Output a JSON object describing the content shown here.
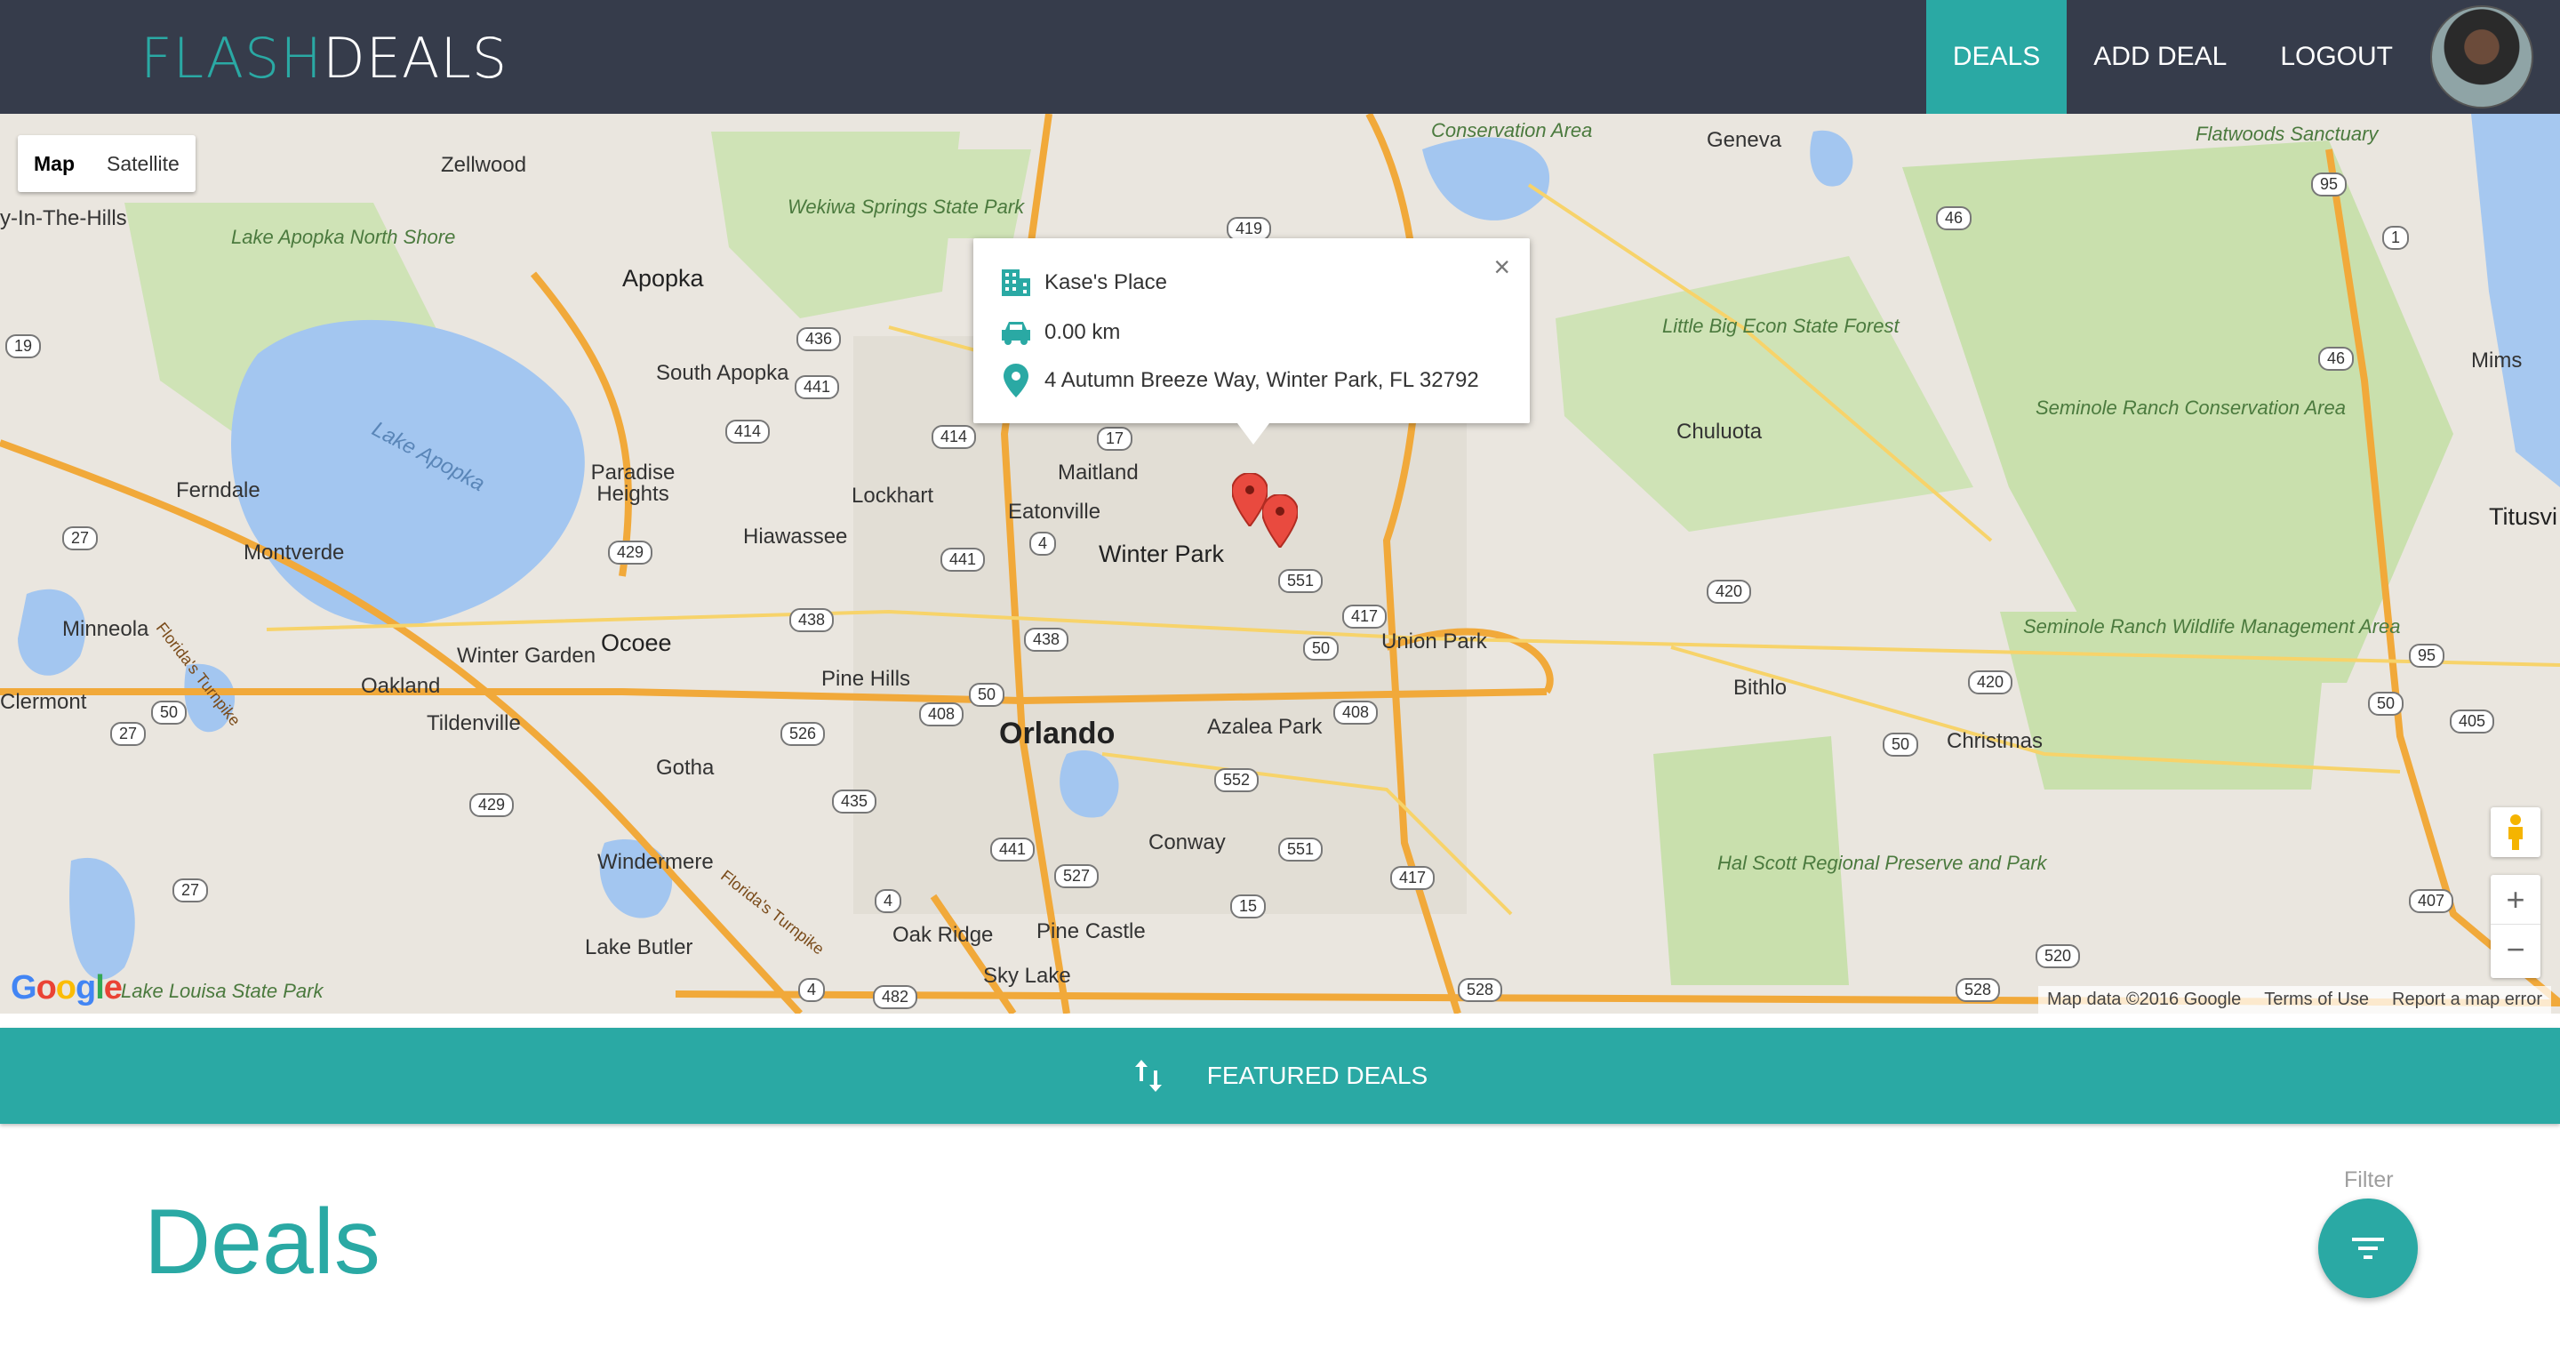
{
  "header": {
    "logo_part1": "FLASH",
    "logo_part2": "DEALS",
    "nav": [
      {
        "label": "DEALS",
        "active": true
      },
      {
        "label": "ADD DEAL",
        "active": false
      },
      {
        "label": "LOGOUT",
        "active": false
      }
    ]
  },
  "map": {
    "type_controls": {
      "map": "Map",
      "satellite": "Satellite",
      "selected": "Map"
    },
    "info_window": {
      "name": "Kase's Place",
      "distance": "0.00 km",
      "address": "4 Autumn Breeze Way, Winter Park, FL 32792",
      "close": "×"
    },
    "labels": {
      "zellwood": "Zellwood",
      "geneva": "Geneva",
      "apopka": "Apopka",
      "south_apopka": "South Apopka",
      "lake_apopka_north_shore": "Lake Apopka North Shore",
      "lake_apopka": "Lake Apopka",
      "wekiwa": "Wekiwa Springs State Park",
      "ferndale": "Ferndale",
      "paradise_heights": "Paradise Heights",
      "lockhart": "Lockhart",
      "maitland": "Maitland",
      "eatonville": "Eatonville",
      "winter_park": "Winter Park",
      "hiawassee": "Hiawassee",
      "montverde": "Montverde",
      "minneola": "Minneola",
      "ocoee": "Ocoee",
      "winter_garden": "Winter Garden",
      "oakland": "Oakland",
      "clermont": "Clermont",
      "tildenville": "Tildenville",
      "pine_hills": "Pine Hills",
      "orlando": "Orlando",
      "azalea_park": "Azalea Park",
      "union_park": "Union Park",
      "gotha": "Gotha",
      "conway": "Conway",
      "windermere": "Windermere",
      "pine_castle": "Pine Castle",
      "oak_ridge": "Oak Ridge",
      "lake_butler": "Lake Butler",
      "sky_lake": "Sky Lake",
      "lake_louisa": "Lake Louisa State Park",
      "chuluota": "Chuluota",
      "little_big_econ": "Little Big Econ State Forest",
      "seminole_conservation": "Seminole Ranch Conservation Area",
      "seminole_wildlife": "Seminole Ranch Wildlife Management Area",
      "bithlo": "Bithlo",
      "christmas": "Christmas",
      "hal_scott": "Hal Scott Regional Preserve and Park",
      "mims": "Mims",
      "titusville": "Titusvi",
      "flatwoods": "Flatwoods Sanctuary",
      "conservation_area": "Conservation Area",
      "hills": "y-In-The-Hills",
      "florida_turnpike": "Florida's Turnpike"
    },
    "shields": [
      "419",
      "436",
      "441",
      "414",
      "17",
      "414",
      "429",
      "441",
      "438",
      "438",
      "408",
      "50",
      "526",
      "435",
      "441",
      "408",
      "552",
      "551",
      "417",
      "50",
      "15",
      "527",
      "482",
      "528",
      "528",
      "520",
      "420",
      "420",
      "50",
      "405",
      "407",
      "46",
      "46",
      "95",
      "1",
      "27",
      "27",
      "50",
      "429",
      "27",
      "19",
      "4",
      "4",
      "4",
      "95",
      "50",
      "551",
      "417"
    ],
    "footer": {
      "map_data": "Map data ©2016 Google",
      "terms": "Terms of Use",
      "report": "Report a map error"
    },
    "google": "Google"
  },
  "featured": {
    "label": "FEATURED DEALS"
  },
  "deals": {
    "title": "Deals",
    "filter_label": "Filter"
  },
  "colors": {
    "accent": "#2aa9a4",
    "header_bg": "#363c4b"
  }
}
